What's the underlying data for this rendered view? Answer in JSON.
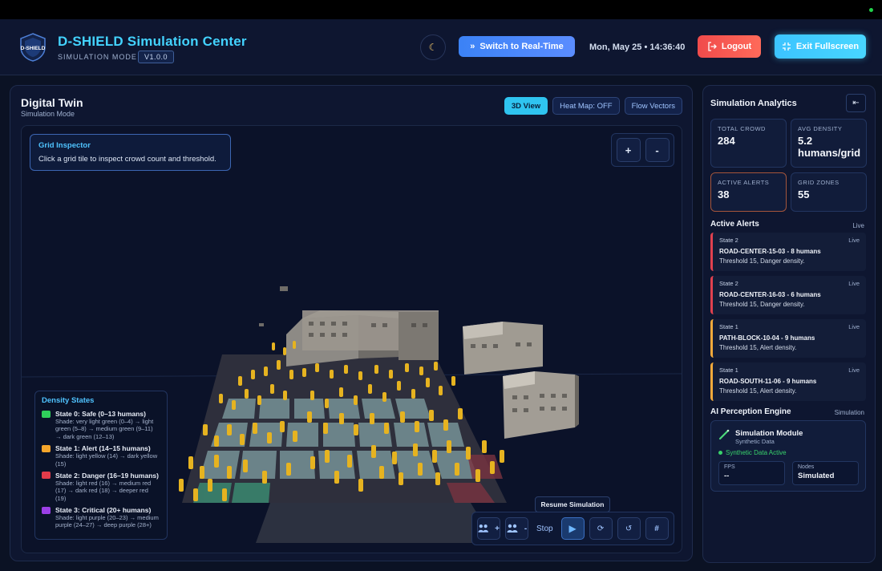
{
  "header": {
    "title": "D-SHIELD Simulation Center",
    "logo_text": "D-SHIELD",
    "mode_label": "SIMULATION MODE",
    "version": "V1.0.0",
    "theme_icon": "moon-icon",
    "switch_label": "Switch to Real-Time",
    "datetime": "Mon, May 25 • 14:36:40",
    "logout_label": "Logout",
    "exit_fullscreen_label": "Exit Fullscreen"
  },
  "twin": {
    "title": "Digital Twin",
    "subtitle": "Simulation Mode",
    "tabs": [
      {
        "label": "3D View",
        "active": true
      },
      {
        "label": "Heat Map: OFF",
        "active": false
      },
      {
        "label": "Flow Vectors",
        "active": false
      }
    ],
    "inspector": {
      "title": "Grid Inspector",
      "description": "Click a grid tile to inspect crowd count and threshold."
    },
    "zoom": {
      "in_label": "+",
      "out_label": "-"
    },
    "legend": {
      "title": "Density States",
      "items": [
        {
          "name": "State 0: Safe (0–13 humans)",
          "shade": "Shade: very light green (0–4) → light green (5–8) → medium green (9–11) → dark green (12–13)",
          "color": "#2fcf5b"
        },
        {
          "name": "State 1: Alert (14–15 humans)",
          "shade": "Shade: light yellow (14) → dark yellow (15)",
          "color": "#f4a52b"
        },
        {
          "name": "State 2: Danger (16–19 humans)",
          "shade": "Shade: light red (16) → medium red (17) → dark red (18) → deeper red (19)",
          "color": "#e23b4a"
        },
        {
          "name": "State 3: Critical (20+ humans)",
          "shade": "Shade: light purple (20–23) → medium purple (24–27) → deep purple (28+)",
          "color": "#9b3fe6"
        }
      ]
    },
    "controls": {
      "add_label": "+",
      "remove_label": "-",
      "stop_label": "Stop",
      "tooltip": "Resume Simulation",
      "grid_label": "#"
    }
  },
  "analytics": {
    "title": "Simulation Analytics",
    "stats": [
      {
        "label": "TOTAL CROWD",
        "value": "284"
      },
      {
        "label": "AVG DENSITY",
        "value": "5.2 humans/grid"
      },
      {
        "label": "ACTIVE ALERTS",
        "value": "38"
      },
      {
        "label": "GRID ZONES",
        "value": "55"
      }
    ],
    "alerts_title": "Active Alerts",
    "alerts_tag": "Live",
    "alerts": [
      {
        "state": "State 2",
        "live": "Live",
        "title": "ROAD-CENTER-15-03 - 8 humans",
        "threshold": "Threshold 15, Danger density."
      },
      {
        "state": "State 2",
        "live": "Live",
        "title": "ROAD-CENTER-16-03 - 6 humans",
        "threshold": "Threshold 15, Danger density."
      },
      {
        "state": "State 1",
        "live": "Live",
        "title": "PATH-BLOCK-10-04 - 9 humans",
        "threshold": "Threshold 15, Alert density."
      },
      {
        "state": "State 1",
        "live": "Live",
        "title": "ROAD-SOUTH-11-06 - 9 humans",
        "threshold": "Threshold 15, Alert density."
      }
    ],
    "ai_title": "AI Perception Engine",
    "ai_tag": "Simulation",
    "ai": {
      "module_name": "Simulation Module",
      "module_sub": "Synthetic Data",
      "status": "Synthetic Data Active",
      "fps_label": "FPS",
      "fps_value": "--",
      "nodes_label": "Nodes",
      "nodes_value": "Simulated"
    }
  }
}
